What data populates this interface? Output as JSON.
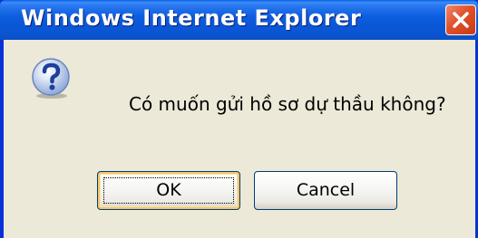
{
  "window": {
    "title": "Windows Internet Explorer"
  },
  "dialog": {
    "icon": "question-icon",
    "message": "Có muốn gửi hồ sơ dự thầu không?",
    "buttons": {
      "ok_label": "OK",
      "cancel_label": "Cancel"
    }
  },
  "colors": {
    "titlebar": "#0a56d6",
    "client_bg": "#ece9d8",
    "close_button": "#e0512a",
    "button_border": "#003c74"
  }
}
